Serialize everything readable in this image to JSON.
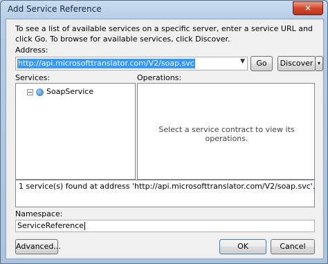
{
  "window": {
    "title": "Add Service Reference",
    "close_glyph": "✕"
  },
  "instructions": "To see a list of available services on a specific server, enter a service URL and click Go. To browse for available services, click Discover.",
  "address": {
    "label": "Address:",
    "value": "http://api.microsofttranslator.com/V2/soap.svc",
    "dropdown_glyph": "▼"
  },
  "buttons": {
    "go": "Go",
    "discover": "Discover",
    "discover_arrow": "▾",
    "advanced": "Advanced...",
    "ok": "OK",
    "cancel": "Cancel"
  },
  "services": {
    "label": "Services:",
    "items": [
      {
        "label": "SoapService",
        "expanded": true
      }
    ]
  },
  "operations": {
    "label": "Operations:",
    "empty_message": "Select a service contract to view its operations."
  },
  "status": "1 service(s) found at address 'http://api.microsofttranslator.com/V2/soap.svc'.",
  "namespace": {
    "label": "Namespace:",
    "value": "ServiceReference"
  },
  "colors": {
    "selection": "#3399ff",
    "dialog_bg": "#f0f0f0",
    "close_button": "#c23419"
  }
}
